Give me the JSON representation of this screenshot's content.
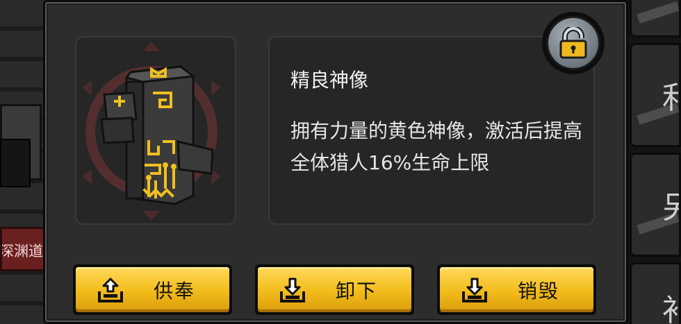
{
  "background": {
    "sign_text": "深渊道",
    "right_tiles": [
      "",
      "利",
      "另",
      "补"
    ]
  },
  "item": {
    "name": "精良神像",
    "description": "拥有力量的黄色神像，激活后提高全体猎人16%生命上限",
    "icon": "yellow-totem-statue-icon"
  },
  "lock": {
    "icon": "padlock-unlocked-icon"
  },
  "buttons": [
    {
      "label": "供奉",
      "icon": "upload-tray-icon"
    },
    {
      "label": "卸下",
      "icon": "download-tray-icon"
    },
    {
      "label": "销毁",
      "icon": "download-tray-icon"
    }
  ],
  "colors": {
    "panel": "#2d2d2d",
    "button_yellow": "#f2bb1a",
    "totem_glow": "#f0c020",
    "ring": "#5a3030"
  }
}
